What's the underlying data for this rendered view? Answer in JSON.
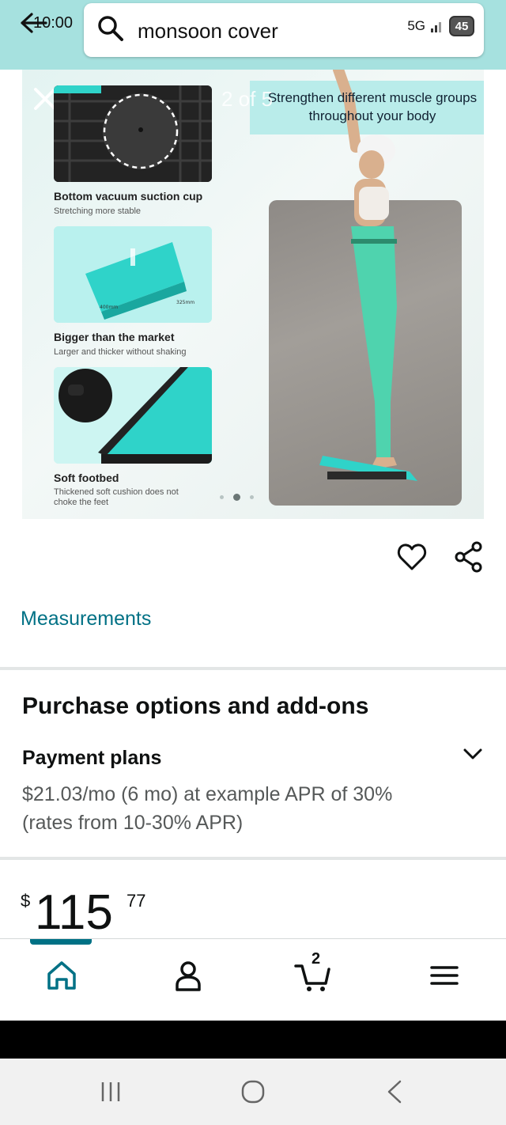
{
  "status_bar": {
    "time": "10:00",
    "network": "5G",
    "battery": "45"
  },
  "search": {
    "query": "monsoon cover"
  },
  "gallery": {
    "counter": "2 of 5",
    "headline": "Strengthen different muscle groups throughout your body",
    "features": [
      {
        "title": "Bottom vacuum suction cup",
        "subtitle": "Stretching more stable"
      },
      {
        "title": "Bigger than the market",
        "subtitle": "Larger and thicker without shaking"
      },
      {
        "title": "Soft footbed",
        "subtitle": "Thickened soft cushion does not choke the feet"
      }
    ],
    "dimension_labels": [
      "400mm",
      "325mm"
    ]
  },
  "links": {
    "measurements": "Measurements"
  },
  "purchase": {
    "section_title": "Purchase options and add-ons",
    "payment_plans_title": "Payment plans",
    "payment_plans_desc": "$21.03/mo (6 mo) at example APR of 30% (rates from 10-30% APR)"
  },
  "price": {
    "symbol": "$",
    "whole": "115",
    "fraction": "77"
  },
  "tabbar": {
    "cart_count": "2",
    "items": [
      "home-icon",
      "account-icon",
      "cart-icon",
      "menu-icon"
    ]
  },
  "colors": {
    "header_bg": "#a6e1df",
    "link": "#007185",
    "accent_teal": "#2fd3c9"
  }
}
